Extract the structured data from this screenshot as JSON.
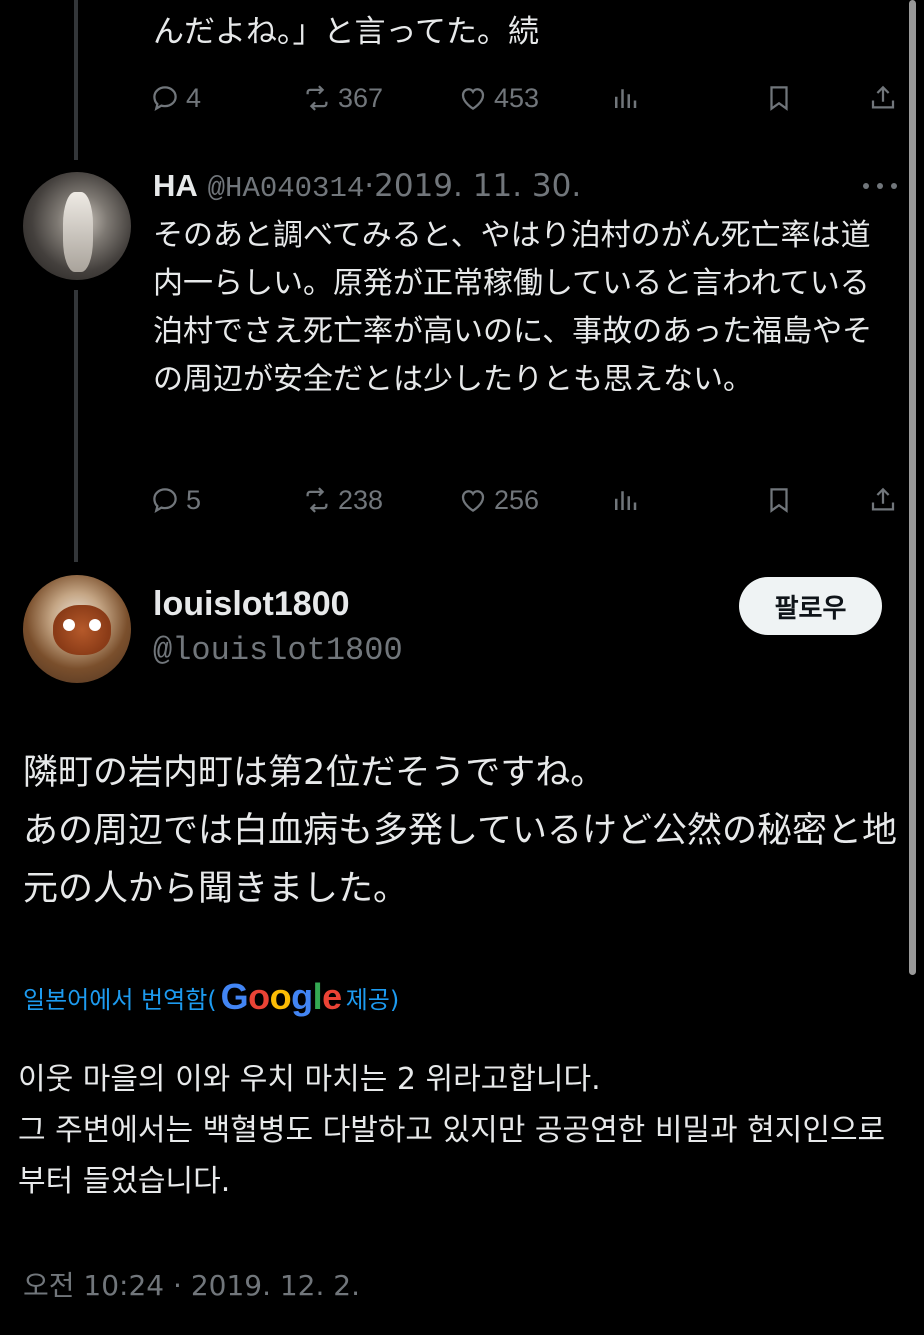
{
  "prev_tweet": {
    "text_tail": "んだよね。」と言ってた。続",
    "actions": {
      "replies": "4",
      "reposts": "367",
      "likes": "453"
    }
  },
  "reply": {
    "name": "HA",
    "handle": "@HA040314",
    "separator": "·",
    "date": "2019. 11. 30.",
    "text": "そのあと調べてみると、やはり泊村のがん死亡率は道内一らしい。原発が正常稼働していると言われている泊村でさえ死亡率が高いのに、事故のあった福島やその周辺が安全だとは少したりとも思えない。",
    "actions": {
      "replies": "5",
      "reposts": "238",
      "likes": "256"
    }
  },
  "main_tweet": {
    "name": "louislot1800",
    "handle": "@louislot1800",
    "follow_label": "팔로우",
    "text_line1": "隣町の岩内町は第2位だそうですね。",
    "text_line2": "あの周辺では白血病も多発しているけど公然の秘密と地元の人から聞きました。",
    "translated_from": "일본어에서 번역함(",
    "translation_provider": "Google",
    "translation_suffix": " 제공)",
    "translated_line1": "이웃 마을의 이와 우치 마치는 2 위라고합니다.",
    "translated_line2": "그 주변에서는 백혈병도 다발하고 있지만 공공연한 비밀과 현지인으로부터 들었습니다.",
    "timestamp": "오전 10:24 · 2019. 12. 2."
  },
  "icons": {
    "reply": "reply-icon",
    "repost": "repost-icon",
    "like": "heart-icon",
    "views": "views-icon",
    "bookmark": "bookmark-icon",
    "share": "share-icon",
    "more": "more-icon"
  },
  "colors": {
    "background": "#000000",
    "text": "#e7e9ea",
    "secondary": "#71767b",
    "link": "#1d9bf0",
    "follow_bg": "#eff3f4"
  }
}
